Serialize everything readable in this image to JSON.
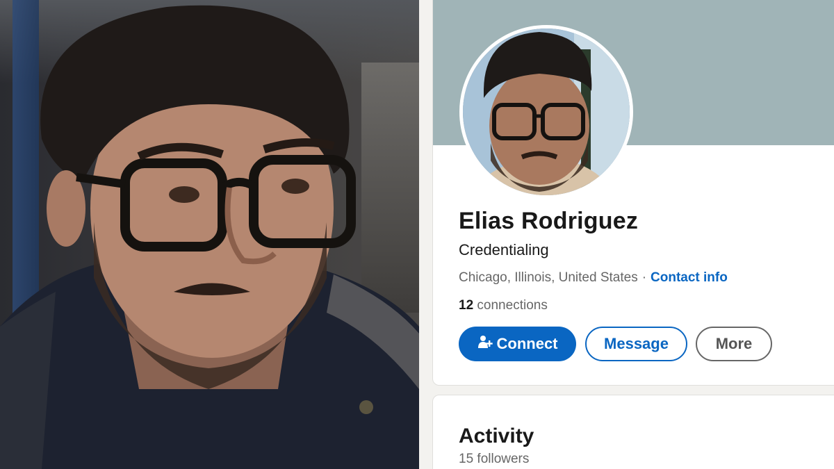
{
  "profile": {
    "name": "Elias Rodriguez",
    "headline": "Credentialing",
    "location": "Chicago, Illinois, United States",
    "separator": "·",
    "contact_info_label": "Contact info",
    "connections_count": "12",
    "connections_label": "connections"
  },
  "actions": {
    "connect_label": "Connect",
    "message_label": "Message",
    "more_label": "More"
  },
  "activity": {
    "title": "Activity",
    "followers": "15 followers"
  },
  "icons": {
    "connect": "add-person-icon"
  },
  "colors": {
    "accent": "#0a66c2",
    "cover": "#a0b4b7",
    "background": "#f3f2ef"
  }
}
